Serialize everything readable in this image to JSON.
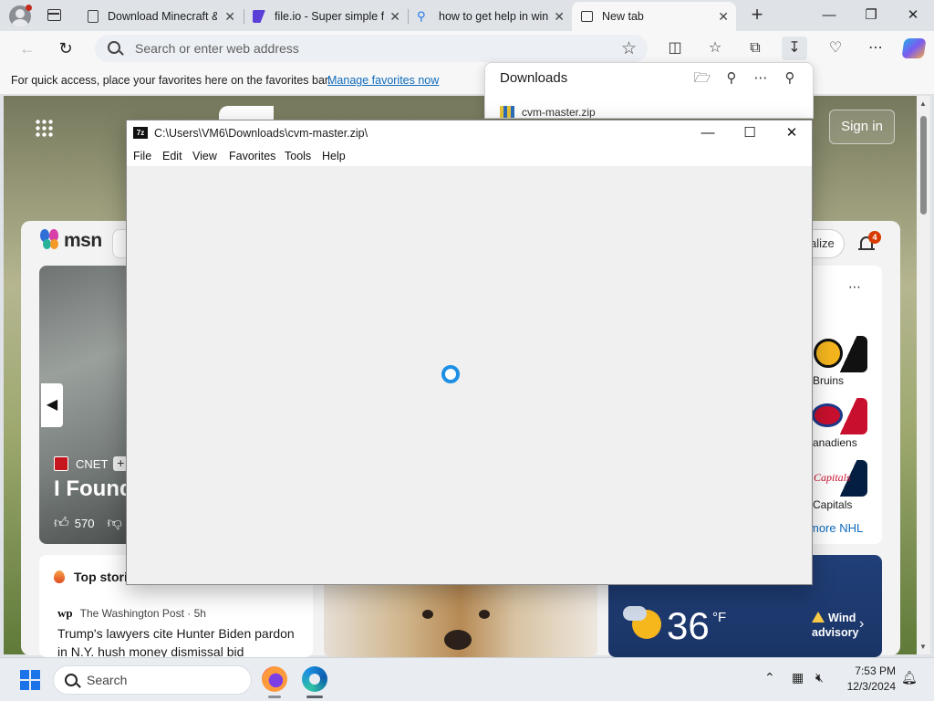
{
  "browser": {
    "tabs": [
      {
        "title": "Download Minecraft & ",
        "icon": "document-icon",
        "active": false
      },
      {
        "title": "file.io - Super simple f",
        "icon": "fileio-icon",
        "active": false
      },
      {
        "title": "how to get help in win",
        "icon": "search-icon",
        "active": false
      },
      {
        "title": "New tab",
        "icon": "newtab-icon",
        "active": true
      }
    ],
    "address_placeholder": "Search or enter web address",
    "favorites_bar": {
      "message": "For quick access, place your favorites here on the favorites bar.",
      "link": "Manage favorites now"
    }
  },
  "downloads": {
    "title": "Downloads",
    "items": [
      {
        "name": "cvm-master.zip"
      }
    ]
  },
  "new_tab": {
    "sign_in": "Sign in",
    "msn_logo": "msn",
    "personalize_partial": "alize",
    "notification_count": "4",
    "hero": {
      "source": "CNET",
      "title_partial": "I Found",
      "likes": "570"
    },
    "top_stories": {
      "heading": "Top stori",
      "source": "The Washington Post · 5h",
      "headline": "Trump's lawyers cite Hunter Biden pardon in N.Y. hush money dismissal bid"
    },
    "nhl": {
      "teams": [
        "Bruins",
        "anadiens",
        "Capitals"
      ],
      "more": "more NHL"
    },
    "weather": {
      "temperature": "36",
      "unit": "°F",
      "alert_line1": "Wind",
      "alert_line2": "advisory"
    }
  },
  "zip_window": {
    "title": "C:\\Users\\VM6\\Downloads\\cvm-master.zip\\",
    "app_icon_label": "7z",
    "menu": [
      "File",
      "Edit",
      "View",
      "Favorites",
      "Tools",
      "Help"
    ]
  },
  "taskbar": {
    "search_label": "Search",
    "time": "7:53 PM",
    "date": "12/3/2024"
  },
  "colors": {
    "accent": "#0f6cbd",
    "weather_bg": "#1a3466",
    "notification_badge": "#d83b01",
    "spinner": "#1e90e6"
  }
}
